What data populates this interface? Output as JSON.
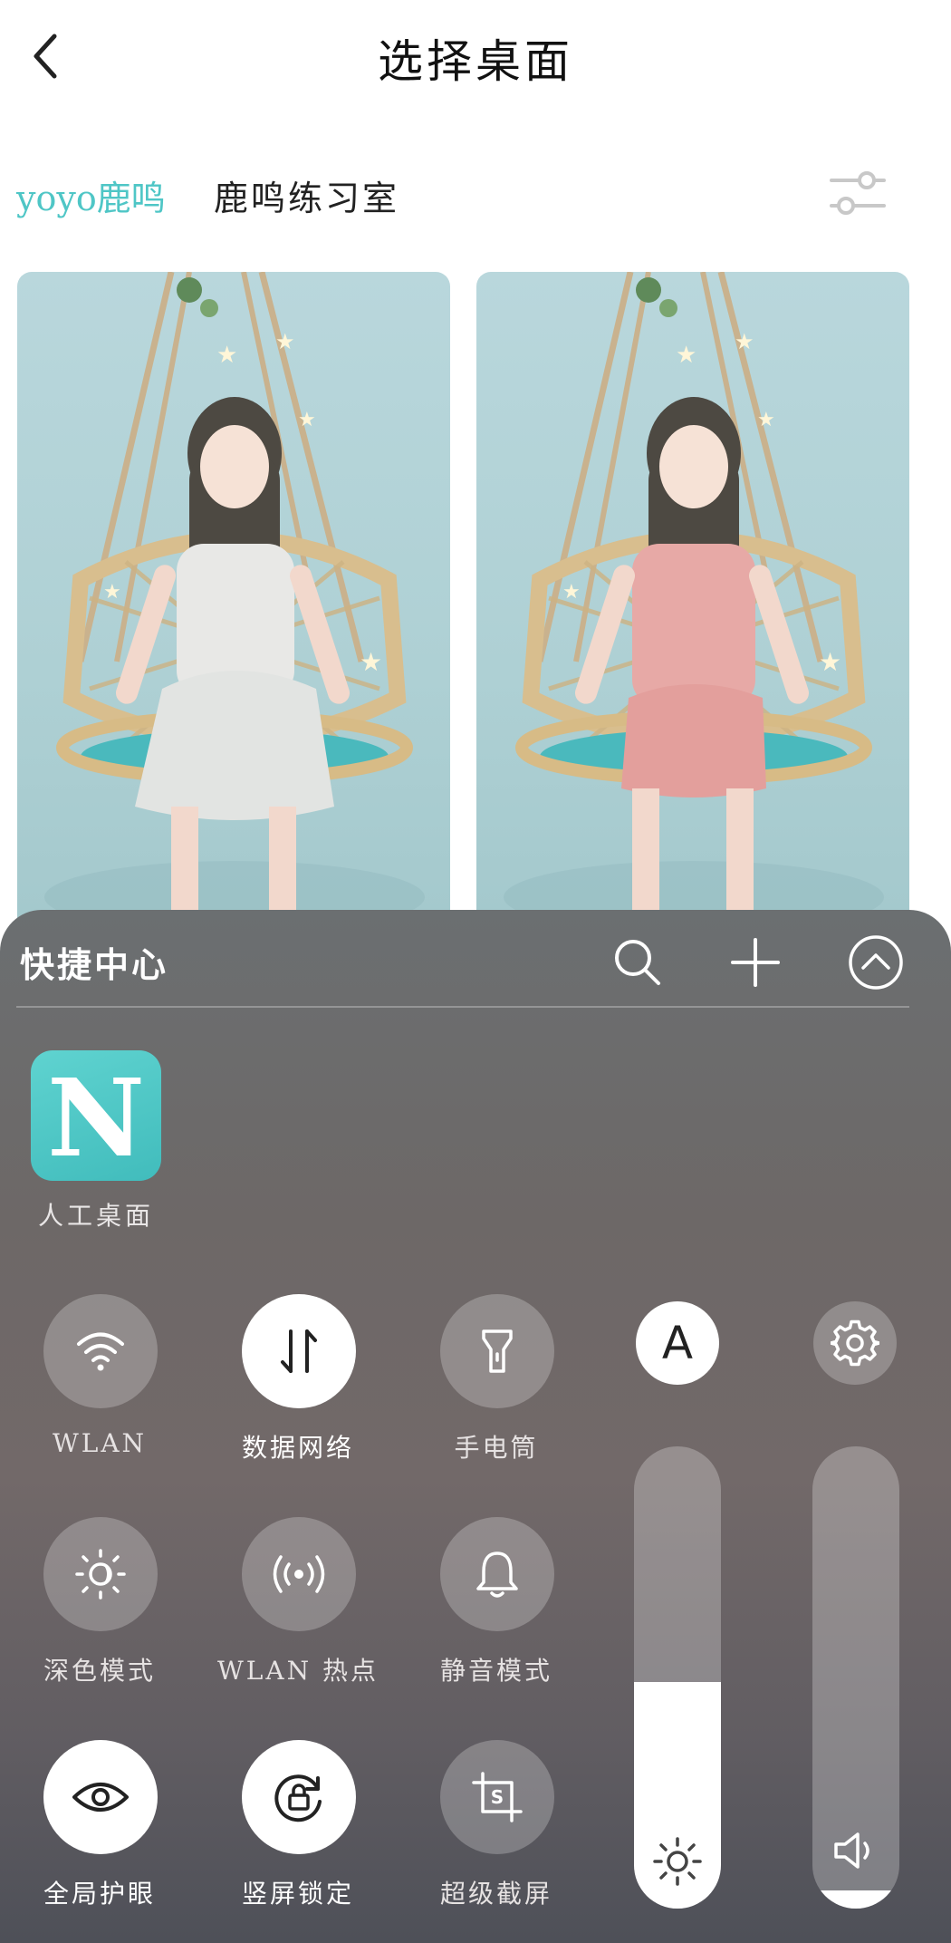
{
  "header": {
    "title": "选择桌面",
    "back_icon": "chevron-left-icon"
  },
  "tabs": {
    "active": "yoyo鹿鸣",
    "inactive": "鹿鸣练习室",
    "active_color": "#4fc6c6",
    "filter_icon": "sliders-icon"
  },
  "wallpapers": [
    {
      "image": "girl-white-dress-on-swing"
    },
    {
      "image": "girl-pink-dress-on-swing"
    }
  ],
  "quick_center": {
    "title": "快捷中心",
    "icons": [
      "search-icon",
      "plus-icon",
      "collapse-up-icon"
    ],
    "app": {
      "letter": "N",
      "label": "人工桌面",
      "color": "#4cc7c7"
    },
    "toggles": [
      {
        "label": "WLAN",
        "icon": "wifi-icon",
        "on": false
      },
      {
        "label": "数据网络",
        "icon": "data-arrows-icon",
        "on": true
      },
      {
        "label": "手电筒",
        "icon": "flashlight-icon",
        "on": false
      },
      {
        "label": "深色模式",
        "icon": "dark-mode-icon",
        "on": false
      },
      {
        "label": "WLAN 热点",
        "icon": "hotspot-icon",
        "on": false
      },
      {
        "label": "静音模式",
        "icon": "bell-icon",
        "on": false
      },
      {
        "label": "全局护眼",
        "icon": "eye-icon",
        "on": true
      },
      {
        "label": "竖屏锁定",
        "icon": "rotation-lock-icon",
        "on": true
      },
      {
        "label": "超级截屏",
        "icon": "screenshot-icon",
        "on": false
      }
    ],
    "auto_brightness": {
      "letter": "A",
      "icon": "auto-brightness-icon"
    },
    "settings_icon": "gear-icon",
    "brightness": {
      "level": 0.49,
      "icon": "sun-icon"
    },
    "volume": {
      "level": 0.04,
      "icon": "speaker-icon"
    }
  }
}
